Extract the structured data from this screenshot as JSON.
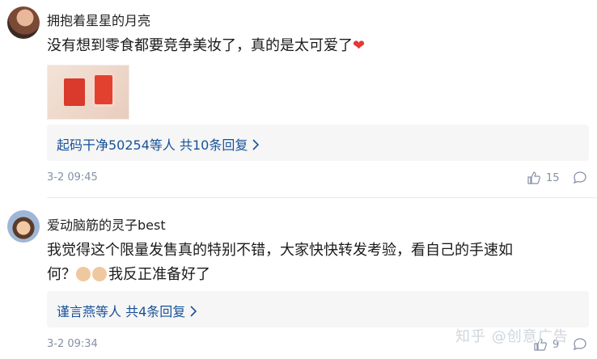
{
  "comments": [
    {
      "username": "拥抱着星星的月亮",
      "text": "没有想到零食都要竞争美妆了，真的是太可爱了",
      "replies_link": "起码干净50254等人",
      "replies_count": "共10条回复",
      "time": "3-2 09:45",
      "likes": "15",
      "has_image": true
    },
    {
      "username": "爱动脑筋的灵子best",
      "text_line1": "我觉得这个限量发售真的特别不错，大家快快转发考验，看自己的手速如",
      "text_line2_prefix": "何？",
      "text_line2_suffix": "我反正准备好了",
      "replies_link": "谨言燕等人",
      "replies_count": "共4条回复",
      "time": "3-2 09:34",
      "likes": "9"
    }
  ],
  "icons": {
    "like": "thumbs-up-icon",
    "reply": "reply-bubble-icon",
    "chevron": "chevron-right-icon",
    "heart": "red-heart-emoji"
  },
  "watermark": "知乎 @创意广告",
  "colors": {
    "link": "#175199",
    "meta": "#8590a6",
    "reply_bg": "#f6f6f6"
  }
}
